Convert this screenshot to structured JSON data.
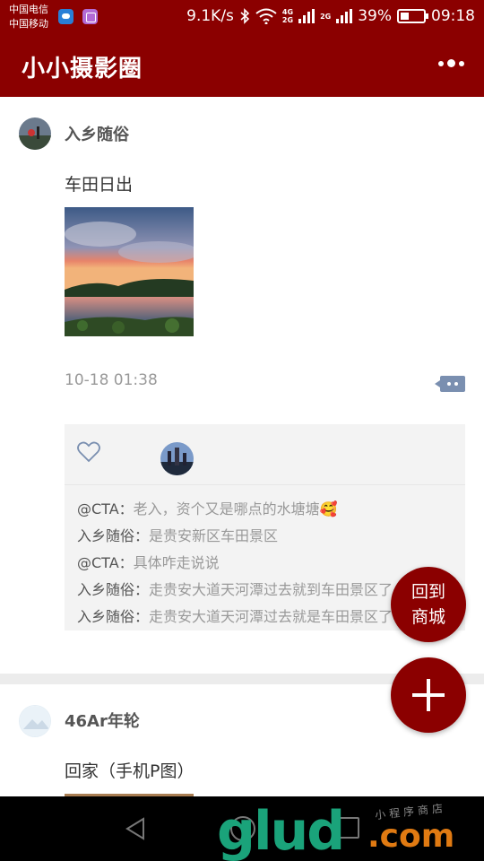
{
  "status_bar": {
    "carrier1": "中国电信",
    "carrier2": "中国移动",
    "net_speed": "9.1K/s",
    "net_type_1": "4G",
    "net_type_1b": "2G",
    "net_type_2": "2G",
    "battery": "39%",
    "battery_level": 0.39,
    "time": "09:18"
  },
  "header": {
    "title": "小小摄影圈",
    "more_icon": "more-dots-icon"
  },
  "posts": [
    {
      "username": "入乡随俗",
      "text": "车田日出",
      "time": "10-18 01:38",
      "comments": [
        {
          "author": "@CTA：",
          "text": "老入，资个又是哪点的水塘塘🥰"
        },
        {
          "author": "入乡随俗：",
          "text": "是贵安新区车田景区"
        },
        {
          "author": "@CTA：",
          "text": "具体咋走说说"
        },
        {
          "author": "入乡随俗：",
          "text": "走贵安大道天河潭过去就到车田景区了"
        },
        {
          "author": "入乡随俗：",
          "text": "走贵安大道天河潭过去就是车田景区了"
        }
      ]
    },
    {
      "username": "46Ar年轮",
      "text": "回家（手机P图）"
    }
  ],
  "fab": {
    "mall_line1": "回到",
    "mall_line2": "商城"
  },
  "watermark": {
    "main": "glud",
    "suffix": ".com",
    "small": "小程序商店"
  },
  "colors": {
    "brand": "#8b0000",
    "icon_blue": "#7a8fb0"
  }
}
